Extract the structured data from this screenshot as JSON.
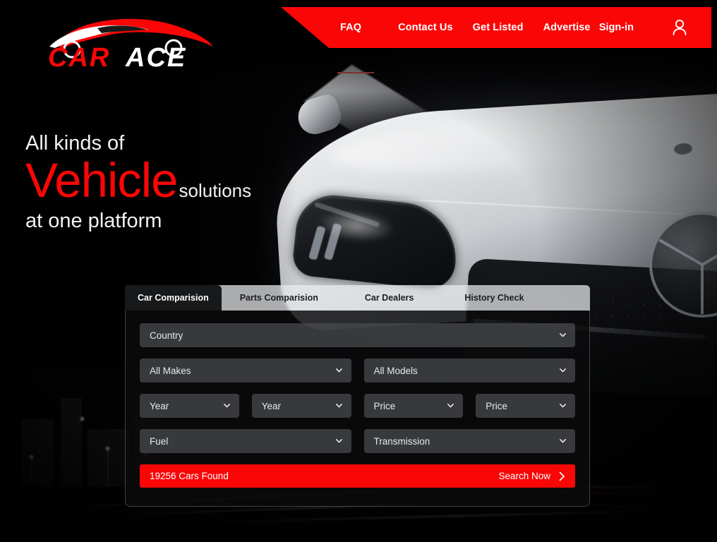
{
  "brand": {
    "name_part1": "CAR",
    "name_part2": "ACE",
    "color_primary": "#fb0606",
    "color_secondary": "#ffffff",
    "logo_icon": "car-silhouette-icon"
  },
  "nav": {
    "items": [
      {
        "label": "FAQ",
        "name": "faq"
      },
      {
        "label": "Contact Us",
        "name": "contact-us"
      },
      {
        "label": "Get Listed",
        "name": "get-listed"
      },
      {
        "label": "Advertise",
        "name": "advertise"
      }
    ],
    "signin_label": "Sign-in",
    "account_icon": "user-account-icon",
    "bar_color": "#fb0606"
  },
  "hero": {
    "line1": "All kinds of",
    "highlight": "Vehicle",
    "highlight_suffix": "solutions",
    "line3": "at one platform",
    "highlight_color": "#fb0606"
  },
  "search_panel": {
    "tabs": [
      {
        "label": "Car Comparision",
        "name": "car-comparision",
        "active": true
      },
      {
        "label": "Parts Comparision",
        "name": "parts-comparision",
        "active": false
      },
      {
        "label": "Car Dealers",
        "name": "car-dealers",
        "active": false
      },
      {
        "label": "History Check",
        "name": "history-check",
        "active": false
      }
    ],
    "fields": {
      "country": "Country",
      "all_makes": "All Makes",
      "all_models": "All Models",
      "year_from": "Year",
      "year_to": "Year",
      "price_from": "Price",
      "price_to": "Price",
      "fuel": "Fuel",
      "transmission": "Transmission"
    },
    "dropdown_icon": "chevron-down-icon",
    "results_count_label": "19256 Cars Found",
    "search_button_label": "Search Now",
    "search_button_icon": "chevron-right-icon",
    "search_button_color": "#fb0606"
  }
}
